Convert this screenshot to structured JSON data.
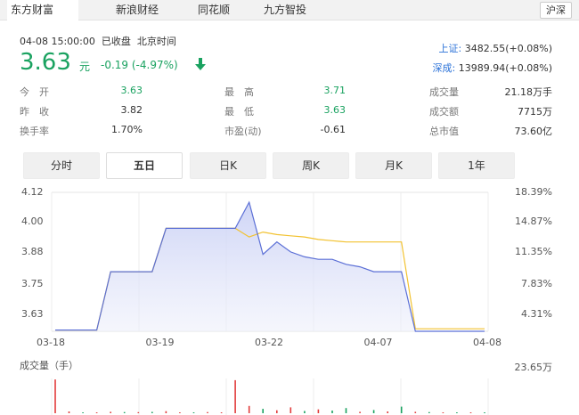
{
  "tabs": [
    {
      "label": "东方财富",
      "active": true
    },
    {
      "label": "新浪财经",
      "active": false
    },
    {
      "label": "同花顺",
      "active": false
    },
    {
      "label": "九方智投",
      "active": false
    }
  ],
  "market_tag": "沪深",
  "header": {
    "datetime": "04-08 15:00:00",
    "status": "已收盘",
    "tz": "北京时间",
    "price": "3.63",
    "unit": "元",
    "change": "-0.19 (-4.97%)"
  },
  "indices": [
    {
      "name": "上证:",
      "value": "3482.55(+0.08%)"
    },
    {
      "name": "深成:",
      "value": "13989.94(+0.08%)"
    }
  ],
  "quote_rows": [
    [
      {
        "label": "今　开",
        "value": "3.63",
        "color": "green"
      },
      {
        "label": "最　高",
        "value": "3.71",
        "color": "green"
      },
      {
        "label": "成交量",
        "value": "21.18万手",
        "color": ""
      }
    ],
    [
      {
        "label": "昨　收",
        "value": "3.82",
        "color": ""
      },
      {
        "label": "最　低",
        "value": "3.63",
        "color": "green"
      },
      {
        "label": "成交额",
        "value": "7715万",
        "color": ""
      }
    ],
    [
      {
        "label": "换手率",
        "value": "1.70%",
        "color": ""
      },
      {
        "label": "市盈(动)",
        "value": "-0.61",
        "color": ""
      },
      {
        "label": "总市值",
        "value": "73.60亿",
        "color": ""
      }
    ]
  ],
  "periods": [
    {
      "label": "分时",
      "active": false
    },
    {
      "label": "五日",
      "active": true
    },
    {
      "label": "日K",
      "active": false
    },
    {
      "label": "周K",
      "active": false
    },
    {
      "label": "月K",
      "active": false
    },
    {
      "label": "1年",
      "active": false
    }
  ],
  "colors": {
    "green": "#1aa260",
    "price_line": "#5b6fd6",
    "avg_line": "#f2c230",
    "vol_up": "#e23c3c",
    "vol_down": "#1aa260"
  },
  "chart_data": {
    "type": "line",
    "y_left_ticks": [
      "4.12",
      "4.00",
      "3.88",
      "3.75",
      "3.63"
    ],
    "y_right_ticks": [
      "18.39%",
      "14.87%",
      "11.35%",
      "7.83%",
      "4.31%"
    ],
    "x_ticks": [
      "03-18",
      "03-19",
      "03-22",
      "04-07",
      "04-08"
    ],
    "ylim": [
      3.56,
      4.12
    ],
    "series": [
      {
        "values": [
          3.565,
          3.565,
          3.565,
          3.565,
          3.8,
          3.8,
          3.8,
          3.8,
          3.975,
          3.975,
          3.975,
          3.975,
          3.975,
          3.975,
          4.08,
          3.87,
          3.92,
          3.88,
          3.86,
          3.85,
          3.85,
          3.83,
          3.82,
          3.8,
          3.8,
          3.8,
          3.56,
          3.56,
          3.56,
          3.56,
          3.56,
          3.56
        ]
      },
      {
        "values": [
          3.565,
          3.565,
          3.565,
          3.565,
          3.8,
          3.8,
          3.8,
          3.8,
          3.975,
          3.975,
          3.975,
          3.975,
          3.975,
          3.975,
          3.94,
          3.96,
          3.95,
          3.945,
          3.94,
          3.93,
          3.925,
          3.92,
          3.92,
          3.92,
          3.92,
          3.92,
          3.57,
          3.57,
          3.57,
          3.57,
          3.57,
          3.57
        ]
      }
    ],
    "volume_title": "成交量（手）",
    "volume_max": "23.65万",
    "volume": [
      {
        "v": 23.0,
        "up": true
      },
      {
        "v": 1.2,
        "up": true
      },
      {
        "v": 0.6,
        "up": false
      },
      {
        "v": 0.5,
        "up": true
      },
      {
        "v": 1.0,
        "up": true
      },
      {
        "v": 0.8,
        "up": false
      },
      {
        "v": 0.7,
        "up": true
      },
      {
        "v": 0.9,
        "up": false
      },
      {
        "v": 1.4,
        "up": true
      },
      {
        "v": 0.6,
        "up": true
      },
      {
        "v": 0.5,
        "up": false
      },
      {
        "v": 0.8,
        "up": true
      },
      {
        "v": 0.6,
        "up": true
      },
      {
        "v": 22.5,
        "up": true
      },
      {
        "v": 5.0,
        "up": true
      },
      {
        "v": 3.0,
        "up": false
      },
      {
        "v": 2.0,
        "up": true
      },
      {
        "v": 4.0,
        "up": true
      },
      {
        "v": 1.5,
        "up": false
      },
      {
        "v": 2.6,
        "up": true
      },
      {
        "v": 1.8,
        "up": false
      },
      {
        "v": 3.5,
        "up": false
      },
      {
        "v": 1.0,
        "up": true
      },
      {
        "v": 2.2,
        "up": false
      },
      {
        "v": 1.2,
        "up": true
      },
      {
        "v": 4.5,
        "up": false
      },
      {
        "v": 1.0,
        "up": true
      },
      {
        "v": 0.8,
        "up": false
      },
      {
        "v": 0.5,
        "up": true
      },
      {
        "v": 0.6,
        "up": false
      },
      {
        "v": 0.4,
        "up": true
      },
      {
        "v": 0.5,
        "up": false
      }
    ]
  }
}
